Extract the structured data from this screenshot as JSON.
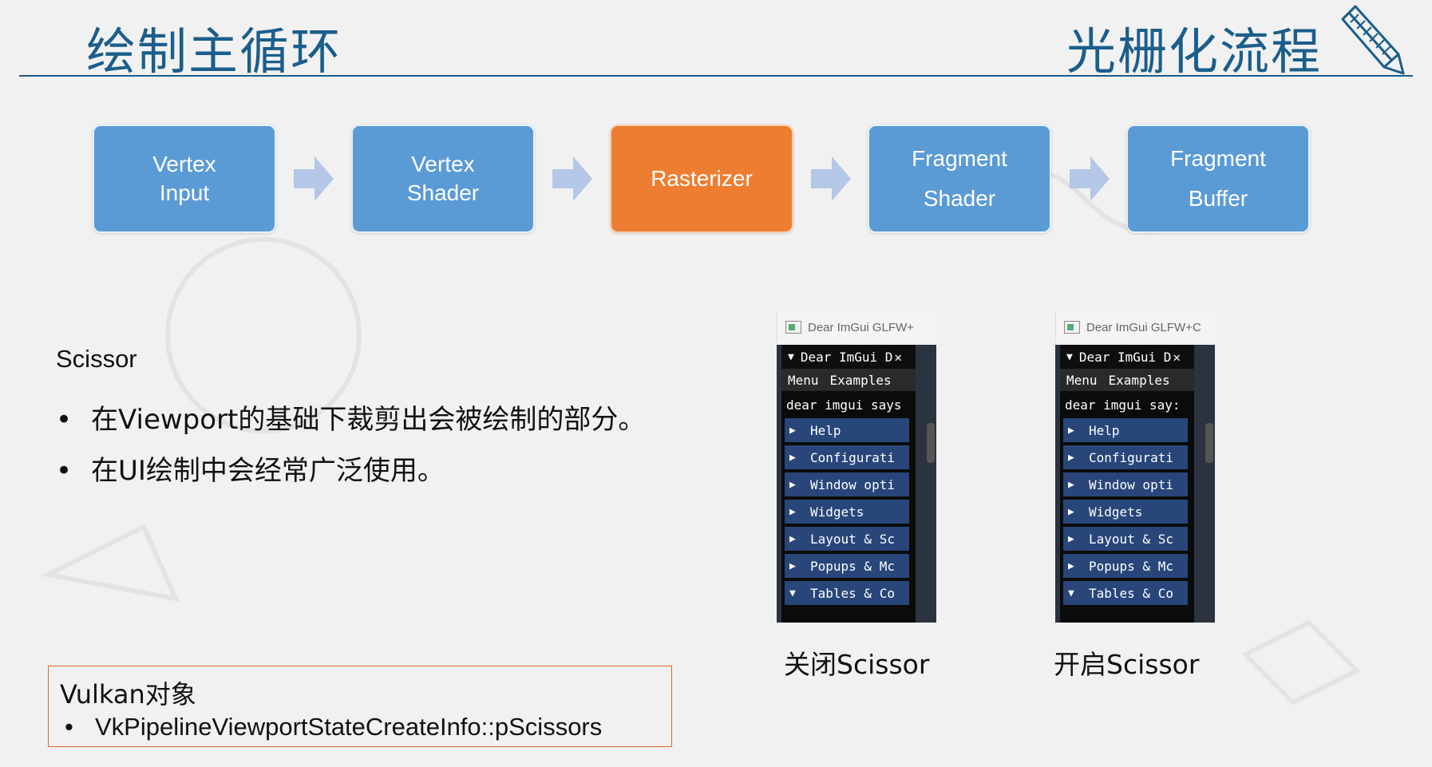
{
  "header": {
    "title_left": "绘制主循环",
    "title_right": "光栅化流程",
    "icon": "pencil-icon"
  },
  "pipeline": [
    {
      "line1": "Vertex",
      "line2": "Input"
    },
    {
      "line1": "Vertex",
      "line2": "Shader"
    },
    {
      "line1": "Rasterizer",
      "line2": ""
    },
    {
      "line1": "Fragment",
      "line2": "Shader"
    },
    {
      "line1": "Fragment",
      "line2": "Buffer"
    }
  ],
  "colors": {
    "stage": "#5b9bd5",
    "active_stage": "#ed7d31",
    "arrow": "#b4c7e7",
    "title": "#1a5e8c"
  },
  "content": {
    "heading": "Scissor",
    "bullets": [
      "在Viewport的基础下裁剪出会被绘制的部分。",
      "在UI绘制中会经常广泛使用。"
    ]
  },
  "vulkan": {
    "title": "Vulkan对象",
    "item": "VkPipelineViewportStateCreateInfo::pScissors"
  },
  "imgui_left": {
    "window_title": "Dear ImGui GLFW+",
    "header": "Dear ImGui D",
    "menu": [
      "Menu",
      "Examples"
    ],
    "says": "dear imgui says",
    "items": [
      "Help",
      "Configurati",
      "Window opti",
      "Widgets",
      "Layout & Sc",
      "Popups & Mc",
      "Tables & Co"
    ],
    "caption": "关闭Scissor"
  },
  "imgui_right": {
    "window_title": "Dear ImGui GLFW+C",
    "header": "Dear ImGui D",
    "menu": [
      "Menu",
      "Examples"
    ],
    "says": "dear imgui say:",
    "items": [
      "Help",
      "Configurati",
      "Window opti",
      "Widgets",
      "Layout & Sc",
      "Popups & Mc",
      "Tables & Co"
    ],
    "caption": "开启Scissor"
  }
}
